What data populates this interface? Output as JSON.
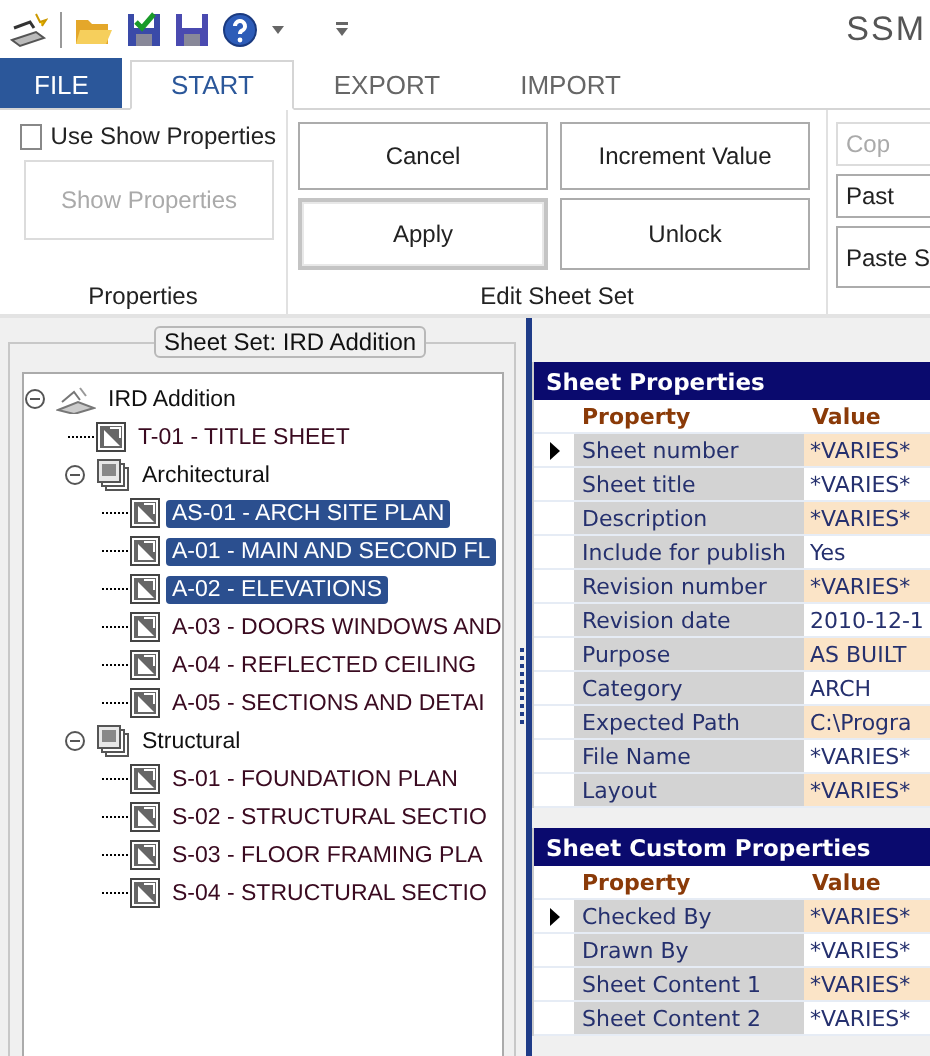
{
  "window": {
    "title": "SSM"
  },
  "ribbon_tabs": [
    {
      "label": "FILE",
      "selected": false,
      "kind": "file"
    },
    {
      "label": "START",
      "selected": true,
      "kind": "tab"
    },
    {
      "label": "EXPORT",
      "selected": false,
      "kind": "tab"
    },
    {
      "label": "IMPORT",
      "selected": false,
      "kind": "tab"
    }
  ],
  "ribbon": {
    "properties_group": {
      "checkbox": {
        "label": "Use Show Properties",
        "checked": false
      },
      "button": {
        "label": "Show Properties",
        "disabled": true
      },
      "label": "Properties"
    },
    "edit_group": {
      "buttons": [
        {
          "label": "Cancel",
          "default": false
        },
        {
          "label": "Increment Value",
          "default": false
        },
        {
          "label": "Apply",
          "default": true
        },
        {
          "label": "Unlock",
          "default": false
        }
      ],
      "label": "Edit Sheet Set"
    },
    "clipboard_group": {
      "buttons": [
        {
          "label": "Cop",
          "disabled": true
        },
        {
          "label": "Past",
          "disabled": false
        },
        {
          "label": "Paste S",
          "disabled": false
        }
      ]
    }
  },
  "sheet_set_panel": {
    "title": "Sheet Set: IRD Addition",
    "tree": [
      {
        "label": "IRD Addition",
        "kind": "set",
        "expanded": true,
        "selected": false,
        "children": [
          {
            "label": "T-01 - TITLE SHEET",
            "kind": "sheet",
            "selected": false
          },
          {
            "label": "Architectural",
            "kind": "subset",
            "expanded": true,
            "selected": false,
            "children": [
              {
                "label": "AS-01 - ARCH SITE PLAN",
                "kind": "sheet",
                "selected": true
              },
              {
                "label": "A-01 - MAIN AND SECOND FL",
                "kind": "sheet",
                "selected": true
              },
              {
                "label": "A-02 - ELEVATIONS",
                "kind": "sheet",
                "selected": true
              },
              {
                "label": "A-03 - DOORS WINDOWS AND",
                "kind": "sheet",
                "selected": false
              },
              {
                "label": "A-04 - REFLECTED CEILING",
                "kind": "sheet",
                "selected": false
              },
              {
                "label": "A-05 - SECTIONS AND DETAI",
                "kind": "sheet",
                "selected": false
              }
            ]
          },
          {
            "label": "Structural",
            "kind": "subset",
            "expanded": true,
            "selected": false,
            "children": [
              {
                "label": "S-01 - FOUNDATION PLAN",
                "kind": "sheet",
                "selected": false
              },
              {
                "label": "S-02 - STRUCTURAL SECTIO",
                "kind": "sheet",
                "selected": false
              },
              {
                "label": "S-03 - FLOOR FRAMING PLA",
                "kind": "sheet",
                "selected": false
              },
              {
                "label": "S-04 - STRUCTURAL SECTIO",
                "kind": "sheet",
                "selected": false
              }
            ]
          }
        ]
      }
    ]
  },
  "grids": [
    {
      "title": "Sheet Properties",
      "columns": [
        "Property",
        "Value"
      ],
      "rows": [
        {
          "property": "Sheet number",
          "value": "*VARIES*",
          "current": true
        },
        {
          "property": "Sheet title",
          "value": "*VARIES*",
          "current": false
        },
        {
          "property": "Description",
          "value": "*VARIES*",
          "current": false
        },
        {
          "property": "Include for publish",
          "value": "Yes",
          "current": false
        },
        {
          "property": "Revision number",
          "value": "*VARIES*",
          "current": false
        },
        {
          "property": "Revision date",
          "value": "2010-12-1",
          "current": false
        },
        {
          "property": "Purpose",
          "value": "AS BUILT",
          "current": false
        },
        {
          "property": "Category",
          "value": "ARCH",
          "current": false
        },
        {
          "property": "Expected Path",
          "value": "C:\\Progra",
          "current": false
        },
        {
          "property": "File Name",
          "value": "*VARIES*",
          "current": false
        },
        {
          "property": "Layout",
          "value": "*VARIES*",
          "current": false
        }
      ]
    },
    {
      "title": "Sheet Custom Properties",
      "columns": [
        "Property",
        "Value"
      ],
      "rows": [
        {
          "property": "Checked By",
          "value": "*VARIES*",
          "current": true
        },
        {
          "property": "Drawn By",
          "value": "*VARIES*",
          "current": false
        },
        {
          "property": "Sheet Content 1",
          "value": "*VARIES*",
          "current": false
        },
        {
          "property": "Sheet Content 2",
          "value": "*VARIES*",
          "current": false
        }
      ]
    }
  ]
}
